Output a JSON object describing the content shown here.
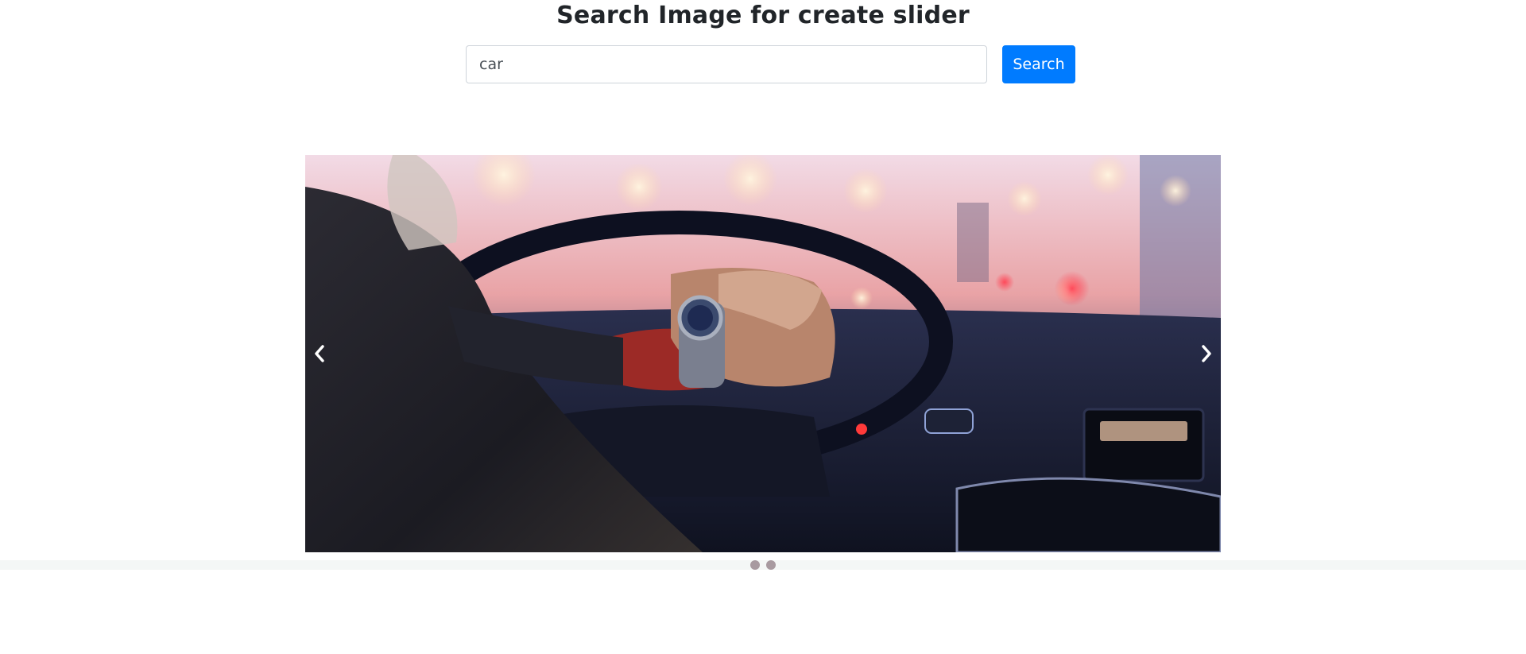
{
  "header": {
    "title": "Search Image for create slider"
  },
  "search": {
    "value": "car",
    "button_label": "Search"
  },
  "carousel": {
    "slide_count": 2,
    "active_index": 0,
    "prev_icon": "chevron-left-icon",
    "next_icon": "chevron-right-icon"
  },
  "colors": {
    "button": "#007bff",
    "indicator": "#a89aa0"
  }
}
